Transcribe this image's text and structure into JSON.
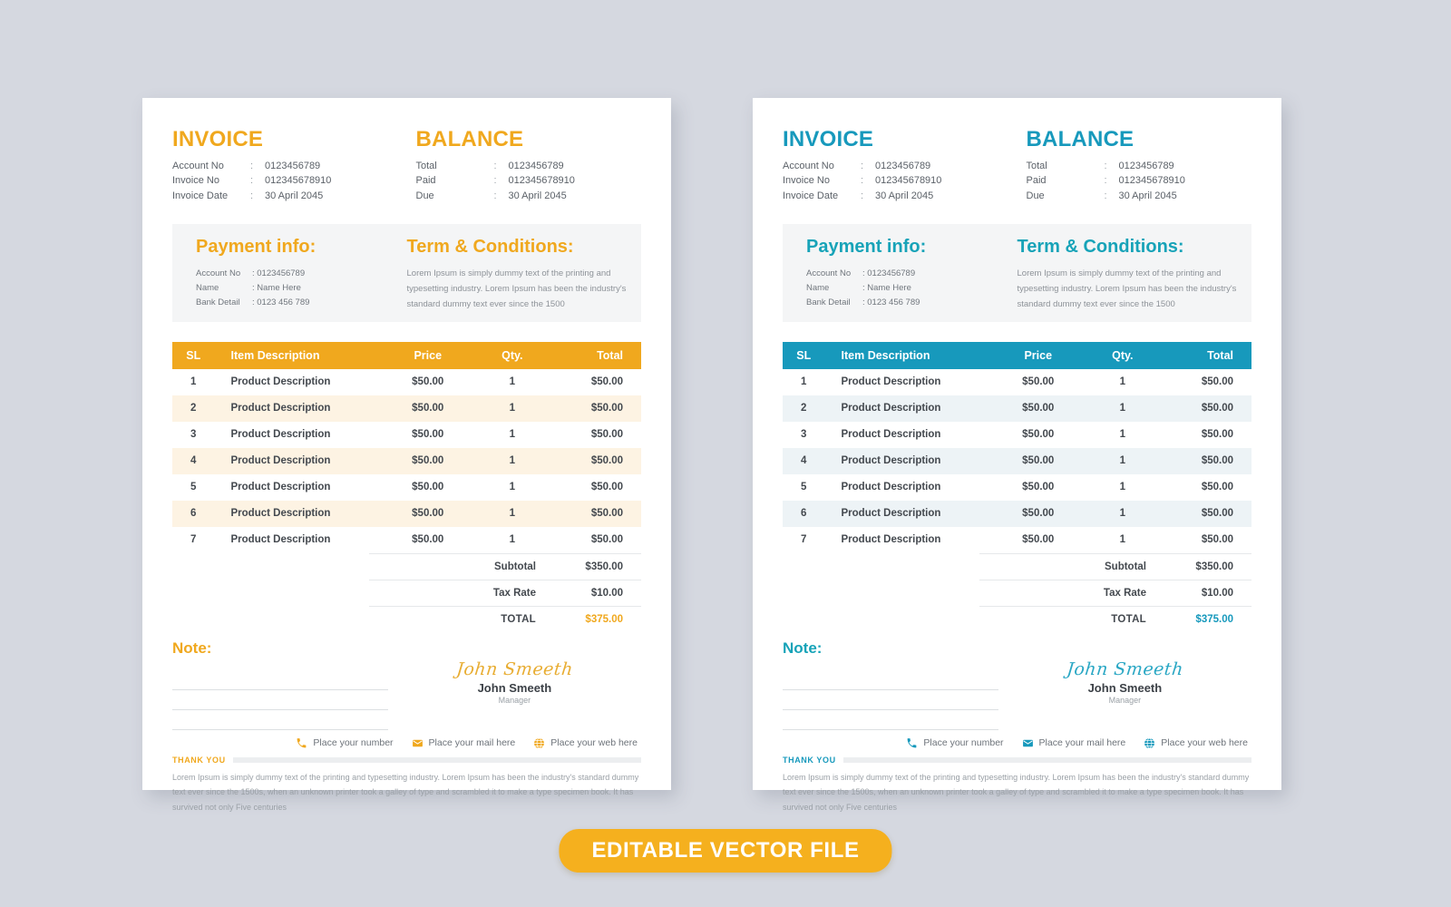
{
  "theme": {
    "page_background": "#d5d8e0",
    "orange_accent": "#f0a81e",
    "teal_accent": "#1799bc",
    "orange_row_tint": "#fdf3e3",
    "teal_row_tint": "#edf3f6",
    "band_background": "#f4f5f6"
  },
  "invoice": {
    "title": "INVOICE",
    "meta": [
      {
        "key": "Account No",
        "sep": ":",
        "value": "0123456789"
      },
      {
        "key": "Invoice No",
        "sep": ":",
        "value": "012345678910"
      },
      {
        "key": "Invoice Date",
        "sep": ":",
        "value": "30 April 2045"
      }
    ]
  },
  "balance": {
    "title": "BALANCE",
    "meta": [
      {
        "key": "Total",
        "sep": ":",
        "value": "0123456789"
      },
      {
        "key": "Paid",
        "sep": ":",
        "value": "012345678910"
      },
      {
        "key": "Due",
        "sep": ":",
        "value": "30 April 2045"
      }
    ]
  },
  "payment_info": {
    "title": "Payment info:",
    "rows": [
      {
        "key": "Account No",
        "value": ": 0123456789"
      },
      {
        "key": "Name",
        "value": ": Name Here"
      },
      {
        "key": "Bank Detail",
        "value": ": 0123 456 789"
      }
    ]
  },
  "terms": {
    "title": "Term & Conditions:",
    "body": "Lorem Ipsum is simply dummy text of the printing and typesetting industry. Lorem Ipsum has been the industry's standard dummy text ever since the 1500"
  },
  "table": {
    "columns": [
      "SL",
      "Item Description",
      "Price",
      "Qty.",
      "Total"
    ],
    "rows": [
      {
        "sl": "1",
        "desc": "Product Description",
        "price": "$50.00",
        "qty": "1",
        "total": "$50.00"
      },
      {
        "sl": "2",
        "desc": "Product Description",
        "price": "$50.00",
        "qty": "1",
        "total": "$50.00"
      },
      {
        "sl": "3",
        "desc": "Product Description",
        "price": "$50.00",
        "qty": "1",
        "total": "$50.00"
      },
      {
        "sl": "4",
        "desc": "Product Description",
        "price": "$50.00",
        "qty": "1",
        "total": "$50.00"
      },
      {
        "sl": "5",
        "desc": "Product Description",
        "price": "$50.00",
        "qty": "1",
        "total": "$50.00"
      },
      {
        "sl": "6",
        "desc": "Product Description",
        "price": "$50.00",
        "qty": "1",
        "total": "$50.00"
      },
      {
        "sl": "7",
        "desc": "Product Description",
        "price": "$50.00",
        "qty": "1",
        "total": "$50.00"
      }
    ]
  },
  "totals": {
    "subtotal_label": "Subtotal",
    "subtotal_value": "$350.00",
    "tax_label": "Tax Rate",
    "tax_value": "$10.00",
    "grand_label": "TOTAL",
    "grand_value": "$375.00"
  },
  "note": {
    "title": "Note:",
    "lines": [
      "",
      "",
      ""
    ]
  },
  "signature": {
    "script": "John Smeeth",
    "name": "John Smeeth",
    "role": "Manager"
  },
  "contacts": [
    {
      "icon": "phone-icon",
      "label": "Place your number"
    },
    {
      "icon": "mail-icon",
      "label": "Place your mail here"
    },
    {
      "icon": "globe-icon",
      "label": "Place your web here"
    }
  ],
  "footer": {
    "thanks": "THANK YOU",
    "body": "Lorem Ipsum is simply dummy text of the printing and typesetting industry. Lorem Ipsum has been the industry's standard dummy text ever since the 1500s, when an unknown printer took a galley of type and scrambled it to make a type specimen book. It has survived not only Five centuries"
  },
  "badge": {
    "label": "EDITABLE VECTOR  FILE"
  }
}
